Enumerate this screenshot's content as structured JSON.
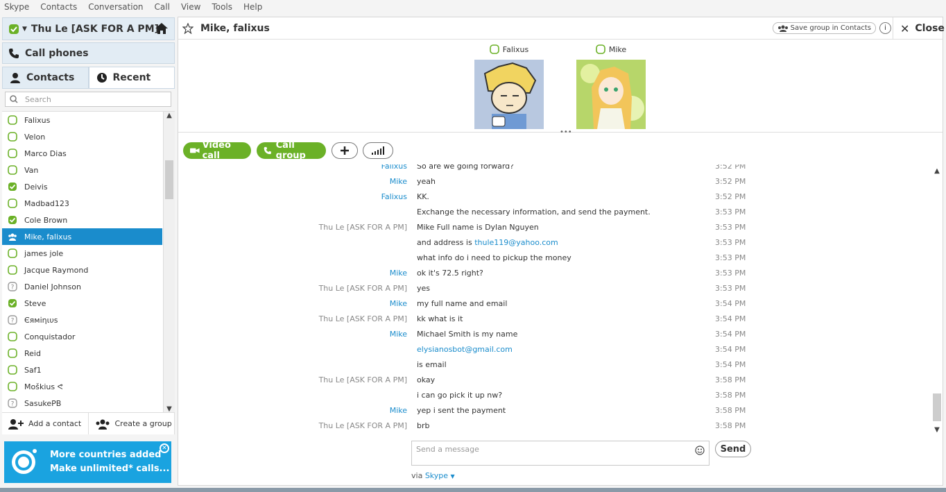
{
  "menubar": [
    "Skype",
    "Contacts",
    "Conversation",
    "Call",
    "View",
    "Tools",
    "Help"
  ],
  "profile": {
    "name": "Thu Le [ASK FOR A PM]"
  },
  "callphones": "Call phones",
  "tabs": {
    "contacts": "Contacts",
    "recent": "Recent"
  },
  "search": {
    "placeholder": "Search"
  },
  "contacts": [
    {
      "name": "Falixus",
      "status": "online"
    },
    {
      "name": "Velon",
      "status": "online"
    },
    {
      "name": "Marco Dias",
      "status": "online"
    },
    {
      "name": "Van",
      "status": "online"
    },
    {
      "name": "Deivis",
      "status": "available"
    },
    {
      "name": "Madbad123",
      "status": "online"
    },
    {
      "name": "Cole Brown",
      "status": "available"
    },
    {
      "name": "Mike, falixus",
      "status": "group"
    },
    {
      "name": "james jole",
      "status": "online"
    },
    {
      "name": "Jacque Raymond",
      "status": "online"
    },
    {
      "name": "Daniel Johnson",
      "status": "unknown"
    },
    {
      "name": "Steve",
      "status": "available"
    },
    {
      "name": "Єяміηιυѕ",
      "status": "unknown"
    },
    {
      "name": "Conquistador",
      "status": "online"
    },
    {
      "name": "Reid",
      "status": "online"
    },
    {
      "name": "Saf1",
      "status": "online"
    },
    {
      "name": "Moškius ᕙ",
      "status": "online"
    },
    {
      "name": "SasukePB",
      "status": "unknown"
    }
  ],
  "leftbottom": {
    "add": "Add a contact",
    "group": "Create a group"
  },
  "promo": {
    "line1": "More countries added",
    "line2": "Make unlimited* calls..."
  },
  "conversation": {
    "title": "Mike, falixus",
    "save_group": "Save group in Contacts",
    "close": "Close",
    "participants": [
      {
        "name": "Falixus"
      },
      {
        "name": "Mike"
      }
    ]
  },
  "actions": {
    "video": "Video call",
    "callgroup": "Call group"
  },
  "messages": [
    {
      "sender": "Falixus",
      "kind": "falixus",
      "text": "So are we going forward?",
      "time": "3:52 PM"
    },
    {
      "sender": "Mike",
      "kind": "mike",
      "text": "yeah",
      "time": "3:52 PM"
    },
    {
      "sender": "Falixus",
      "kind": "falixus",
      "text": "KK.",
      "time": "3:52 PM"
    },
    {
      "sender": "",
      "kind": "falixus",
      "text": "Exchange the necessary information, and send the payment.",
      "time": "3:53 PM"
    },
    {
      "sender": "Thu Le [ASK FOR A PM]",
      "kind": "thu",
      "text": "Mike Full name is Dylan Nguyen",
      "time": "3:53 PM"
    },
    {
      "sender": "",
      "kind": "thu",
      "text": "and address is ",
      "link": "thule119@yahoo.com",
      "time": "3:53 PM"
    },
    {
      "sender": "",
      "kind": "thu",
      "text": "what info do i need to pickup the money",
      "time": "3:53 PM"
    },
    {
      "sender": "Mike",
      "kind": "mike",
      "text": "ok it's 72.5 right?",
      "time": "3:53 PM"
    },
    {
      "sender": "Thu Le [ASK FOR A PM]",
      "kind": "thu",
      "text": "yes",
      "time": "3:53 PM"
    },
    {
      "sender": "Mike",
      "kind": "mike",
      "text": "my full name and email",
      "time": "3:54 PM"
    },
    {
      "sender": "Thu Le [ASK FOR A PM]",
      "kind": "thu",
      "text": "kk what is it",
      "time": "3:54 PM"
    },
    {
      "sender": "Mike",
      "kind": "mike",
      "text": "Michael Smith is my name",
      "time": "3:54 PM"
    },
    {
      "sender": "",
      "kind": "mike",
      "text": "",
      "link": "elysianosbot@gmail.com",
      "time": "3:54 PM"
    },
    {
      "sender": "",
      "kind": "mike",
      "text": "is email",
      "time": "3:54 PM"
    },
    {
      "sender": "Thu Le [ASK FOR A PM]",
      "kind": "thu",
      "text": "okay",
      "time": "3:58 PM"
    },
    {
      "sender": "",
      "kind": "thu",
      "text": "i can go pick it up nw?",
      "time": "3:58 PM"
    },
    {
      "sender": "Mike",
      "kind": "mike",
      "text": "yep i sent the payment",
      "time": "3:58 PM"
    },
    {
      "sender": "Thu Le [ASK FOR A PM]",
      "kind": "thu",
      "text": "brb",
      "time": "3:58 PM"
    }
  ],
  "composer": {
    "placeholder": "Send a message",
    "send": "Send",
    "via": "via",
    "via_app": "Skype"
  },
  "colors": {
    "accent": "#1a8ccc",
    "green": "#6bb127",
    "selected": "#1a8ccc"
  }
}
